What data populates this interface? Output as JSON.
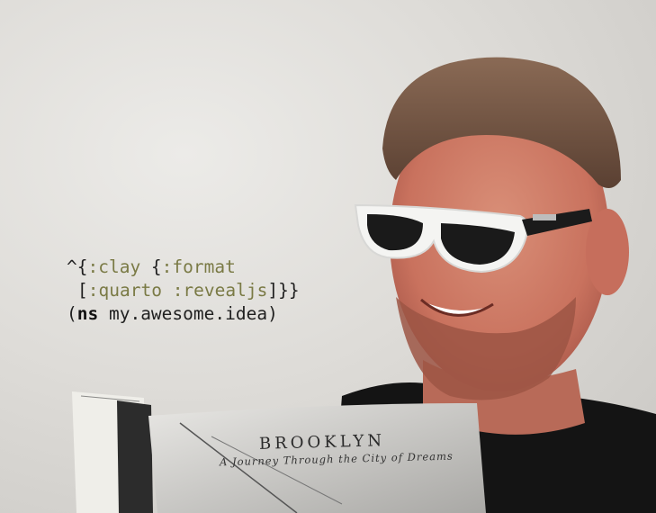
{
  "code": {
    "line1": {
      "caret": "^{",
      "kw1": ":clay",
      "sp1": " {",
      "kw2": ":format"
    },
    "line2": {
      "open": "[",
      "kw1": ":quarto",
      "sp": " ",
      "kw2": ":revealjs",
      "close": "]}}"
    },
    "line3": {
      "open": "(",
      "ns": "ns",
      "rest": " my.awesome.idea)"
    }
  },
  "book": {
    "title": "BROOKLYN",
    "subtitle": "A Journey Through the City of Dreams"
  },
  "colors": {
    "keyword": "#7a7a45",
    "wall": "#dedcd8",
    "shirt": "#141414"
  }
}
